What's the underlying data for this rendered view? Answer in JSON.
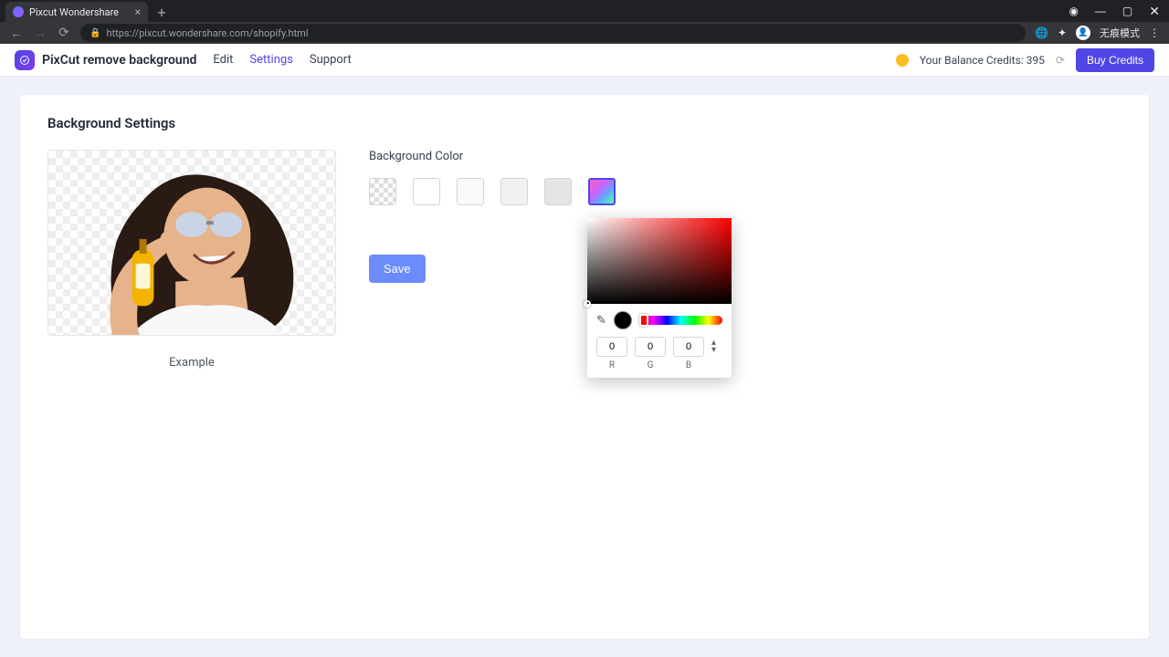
{
  "browser": {
    "tab_title": "Pixcut Wondershare",
    "url": "https://pixcut.wondershare.com/shopify.html",
    "profile_label": "无痕模式"
  },
  "header": {
    "app_title": "PixCut remove background",
    "nav": {
      "edit": "Edit",
      "settings": "Settings",
      "support": "Support"
    },
    "credits_label": "Your Balance Credits: 395",
    "buy_label": "Buy Credits"
  },
  "page": {
    "title": "Background Settings",
    "example_caption": "Example",
    "bg_color_label": "Background Color",
    "save_label": "Save",
    "swatches": {
      "white": "#ffffff",
      "gray1": "#fafafa",
      "gray2": "#f3f4f6",
      "gray3": "#e5e7eb"
    }
  },
  "color_picker": {
    "r": "0",
    "g": "0",
    "b": "0",
    "labels": {
      "r": "R",
      "g": "G",
      "b": "B"
    },
    "current_hex": "#000000"
  }
}
